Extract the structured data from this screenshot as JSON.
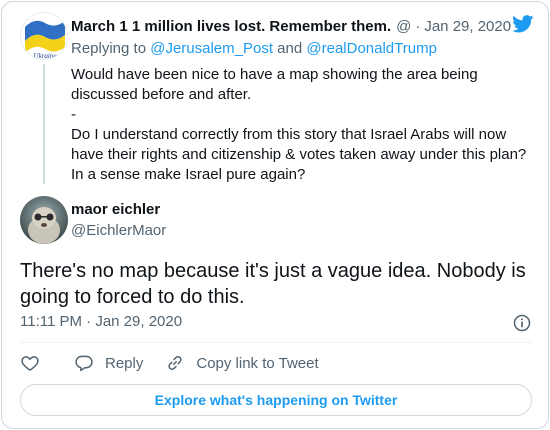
{
  "parent": {
    "display_name": "March 1 1 million lives lost. Remember them.",
    "handle": "@",
    "separator": "·",
    "date": "Jan 29, 2020",
    "avatar_text": "Ukraine",
    "replying_prefix": "Replying to",
    "mention_1": "@Jerusalem_Post",
    "and_text": "and",
    "mention_2": "@realDonaldTrump",
    "body_lines": [
      "Would have been nice to have a map showing the area being",
      "discussed before and after.",
      "-",
      "Do I understand correctly from this story that Israel Arabs will now",
      "have their rights and citizenship & votes taken away under this plan?",
      "In a sense make Israel pure again?"
    ]
  },
  "reply": {
    "display_name": "maor eichler",
    "handle": "@EichlerMaor",
    "body_lines": [
      "There's no map because it's just a vague idea. Nobody is",
      "going to forced to do this."
    ],
    "time": "11:11 PM",
    "separator": "·",
    "date": "Jan 29, 2020"
  },
  "actions": {
    "reply_label": "Reply",
    "copy_link_label": "Copy link to Tweet"
  },
  "explore_label": "Explore what's happening on Twitter",
  "icons": {
    "like": "heart-icon",
    "reply": "speech-bubble-icon",
    "copy": "link-icon",
    "info": "info-icon",
    "brand": "twitter-bird-icon"
  },
  "colors": {
    "accent": "#1d9bf0",
    "text": "#0f1419",
    "muted": "#536471",
    "border": "#cfd9de",
    "flag_blue": "#2f6fc4",
    "flag_yellow": "#f5d21a"
  }
}
